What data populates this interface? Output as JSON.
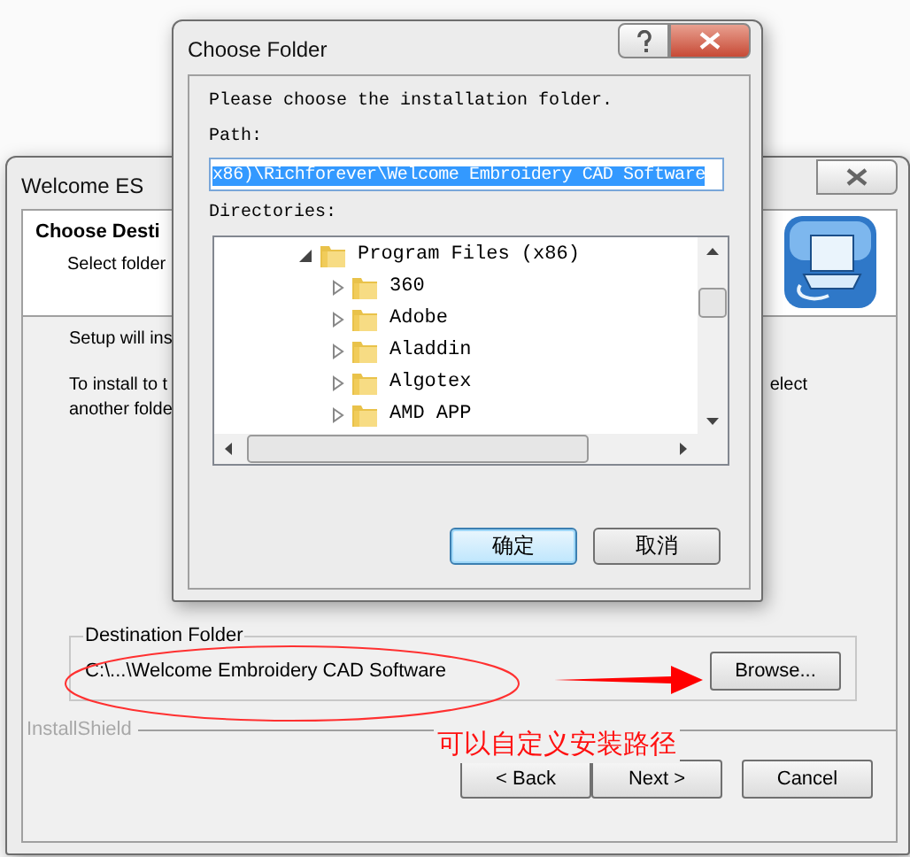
{
  "back_window": {
    "title": "Welcome ES",
    "header_title": "Choose Desti",
    "header_subtitle": "Select folder",
    "setup_text": "Setup will ins",
    "install_text": "To install to t",
    "install_text_right": "elect",
    "another_text": "another folde",
    "group": {
      "legend": "Destination Folder",
      "path": "C:\\...\\Welcome Embroidery CAD Software",
      "button": "Browse..."
    },
    "brand": "InstallShield",
    "buttons": [
      "< Back",
      "Next >",
      "Cancel"
    ]
  },
  "dialog": {
    "title": "Choose Folder",
    "prompt": "Please choose the installation folder.",
    "path_label": "Path:",
    "path": {
      "value": "x86)\\Richforever\\Welcome Embroidery CAD Software",
      "selected": true
    },
    "dir_label": "Directories:",
    "tree": [
      {
        "label": "Program Files (x86)",
        "expanded": true,
        "children": [
          {
            "label": "360",
            "expanded": false
          },
          {
            "label": "Adobe",
            "expanded": false
          },
          {
            "label": "Aladdin",
            "expanded": false
          },
          {
            "label": "Algotex",
            "expanded": false
          },
          {
            "label": "AMD APP",
            "expanded": false
          }
        ]
      }
    ],
    "buttons": [
      {
        "label": "确定",
        "default": true
      },
      {
        "label": "取消",
        "default": false
      }
    ]
  },
  "annotation": {
    "text": "可以自定义安装路径"
  }
}
